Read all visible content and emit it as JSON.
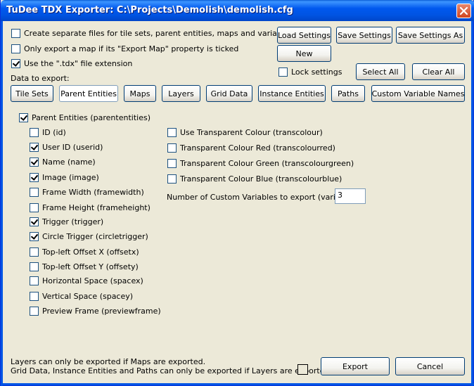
{
  "window": {
    "title": "TuDee TDX Exporter: C:\\Projects\\Demolish\\demolish.cfg"
  },
  "options": {
    "separate_files": "Create separate files for tile sets, parent entities, maps and variable names",
    "export_map_only": "Only export a map if its \"Export Map\" property is ticked",
    "use_tdx_ext": "Use the \".tdx\" file extension",
    "lock_settings": "Lock settings"
  },
  "settings_buttons": {
    "load": "Load Settings",
    "save": "Save Settings",
    "save_as": "Save Settings As",
    "new": "New",
    "select_all": "Select All",
    "clear_all": "Clear All"
  },
  "data_to_export_label": "Data to export:",
  "tabs": [
    {
      "label": "Tile Sets"
    },
    {
      "label": "Parent Entities"
    },
    {
      "label": "Maps"
    },
    {
      "label": "Layers"
    },
    {
      "label": "Grid Data"
    },
    {
      "label": "Instance Entities"
    },
    {
      "label": "Paths"
    },
    {
      "label": "Custom Variable Names"
    }
  ],
  "parent_entities": {
    "main_label": "Parent Entities (parententities)",
    "left_items": [
      {
        "label": "ID (id)",
        "checked": false
      },
      {
        "label": "User ID (userid)",
        "checked": true
      },
      {
        "label": "Name (name)",
        "checked": true
      },
      {
        "label": "Image (image)",
        "checked": true
      },
      {
        "label": "Frame Width (framewidth)",
        "checked": false
      },
      {
        "label": "Frame Height (frameheight)",
        "checked": false
      },
      {
        "label": "Trigger  (trigger)",
        "checked": true
      },
      {
        "label": "Circle Trigger (circletrigger)",
        "checked": true
      },
      {
        "label": "Top-left Offset X (offsetx)",
        "checked": false
      },
      {
        "label": "Top-left Offset Y (offsety)",
        "checked": false
      },
      {
        "label": "Horizontal Space (spacex)",
        "checked": false
      },
      {
        "label": "Vertical Space (spacey)",
        "checked": false
      },
      {
        "label": "Preview Frame (previewframe)",
        "checked": false
      }
    ],
    "right_items": [
      {
        "label": "Use Transparent Colour (transcolour)",
        "checked": false
      },
      {
        "label": "Transparent Colour Red (transcolourred)",
        "checked": false
      },
      {
        "label": "Transparent Colour Green (transcolourgreen)",
        "checked": false
      },
      {
        "label": "Transparent Colour Blue (transcolourblue)",
        "checked": false
      }
    ],
    "custom_vars_label": "Number of Custom Variables to export (variables)",
    "custom_vars_value": "3"
  },
  "footer": {
    "note1": "Layers can only be exported if Maps are exported.",
    "note2": "Grid Data, Instance Entities and Paths can only be exported if Layers are exported.",
    "export": "Export",
    "cancel": "Cancel"
  }
}
